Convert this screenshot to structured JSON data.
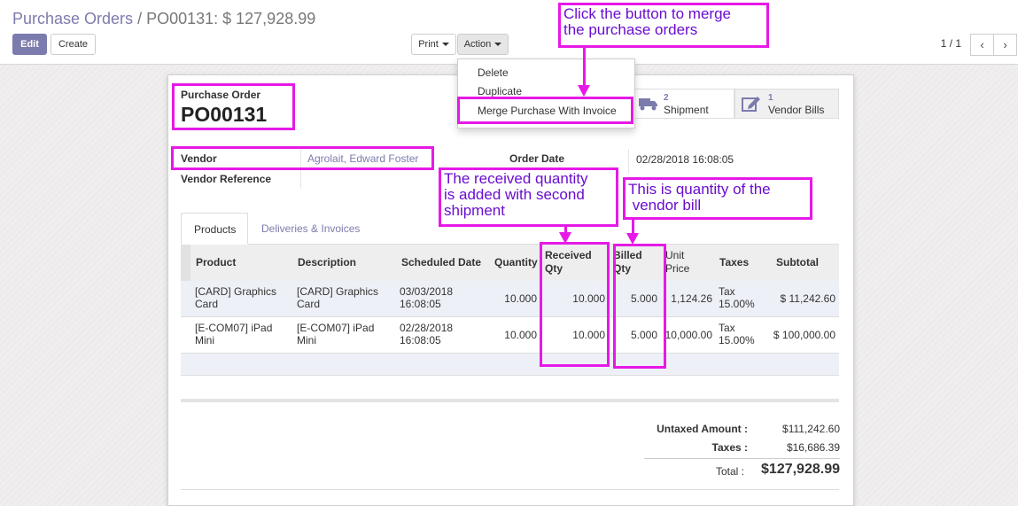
{
  "breadcrumb": {
    "parent": "Purchase Orders",
    "separator": " / ",
    "current": "PO00131: $ 127,928.99"
  },
  "toolbar": {
    "edit_label": "Edit",
    "create_label": "Create",
    "print_label": "Print",
    "action_label": "Action"
  },
  "pager": {
    "value": "1 / 1",
    "prev": "‹",
    "next": "›"
  },
  "action_menu": {
    "items": [
      "Delete",
      "Duplicate",
      "Merge Purchase With Invoice"
    ]
  },
  "stat_buttons": [
    {
      "count": "2",
      "label": "Shipment",
      "icon": "truck-icon"
    },
    {
      "count": "1",
      "label": "Vendor Bills",
      "icon": "edit-icon"
    }
  ],
  "form": {
    "doc_type": "Purchase Order",
    "name": "PO00131",
    "vendor_label": "Vendor",
    "vendor_value": "Agrolait, Edward Foster",
    "vendor_ref_label": "Vendor Reference",
    "order_date_label": "Order Date",
    "order_date_value": "02/28/2018 16:08:05"
  },
  "tabs": [
    "Products",
    "Deliveries & Invoices"
  ],
  "table": {
    "headers": [
      "Product",
      "Description",
      "Scheduled Date",
      "Quantity",
      "Received Qty",
      "Billed Qty",
      "Unit Price",
      "Taxes",
      "Subtotal"
    ],
    "rows": [
      {
        "product": "[CARD] Graphics Card",
        "description": "[CARD] Graphics Card",
        "scheduled": "03/03/2018 16:08:05",
        "quantity": "10.000",
        "received": "10.000",
        "billed": "5.000",
        "unit_price": "1,124.26",
        "taxes": "Tax 15.00%",
        "subtotal": "$ 11,242.60"
      },
      {
        "product": "[E-COM07] iPad Mini",
        "description": "[E-COM07] iPad Mini",
        "scheduled": "02/28/2018 16:08:05",
        "quantity": "10.000",
        "received": "10.000",
        "billed": "5.000",
        "unit_price": "10,000.00",
        "taxes": "Tax 15.00%",
        "subtotal": "$ 100,000.00"
      }
    ]
  },
  "totals": {
    "untaxed_label": "Untaxed Amount :",
    "untaxed_value": "$111,242.60",
    "taxes_label": "Taxes :",
    "taxes_value": "$16,686.39",
    "total_label": "Total :",
    "total_value": "$127,928.99"
  },
  "annotations": {
    "merge": "Click the button to merge\nthe purchase orders",
    "received": "The received quantity\nis added with second\nshipment",
    "billed": "This is quantity of the\n vendor bill"
  },
  "colors": {
    "accent": "#7c7bad",
    "highlight": "#e619e6",
    "annotation_text": "#6a0dcf"
  }
}
